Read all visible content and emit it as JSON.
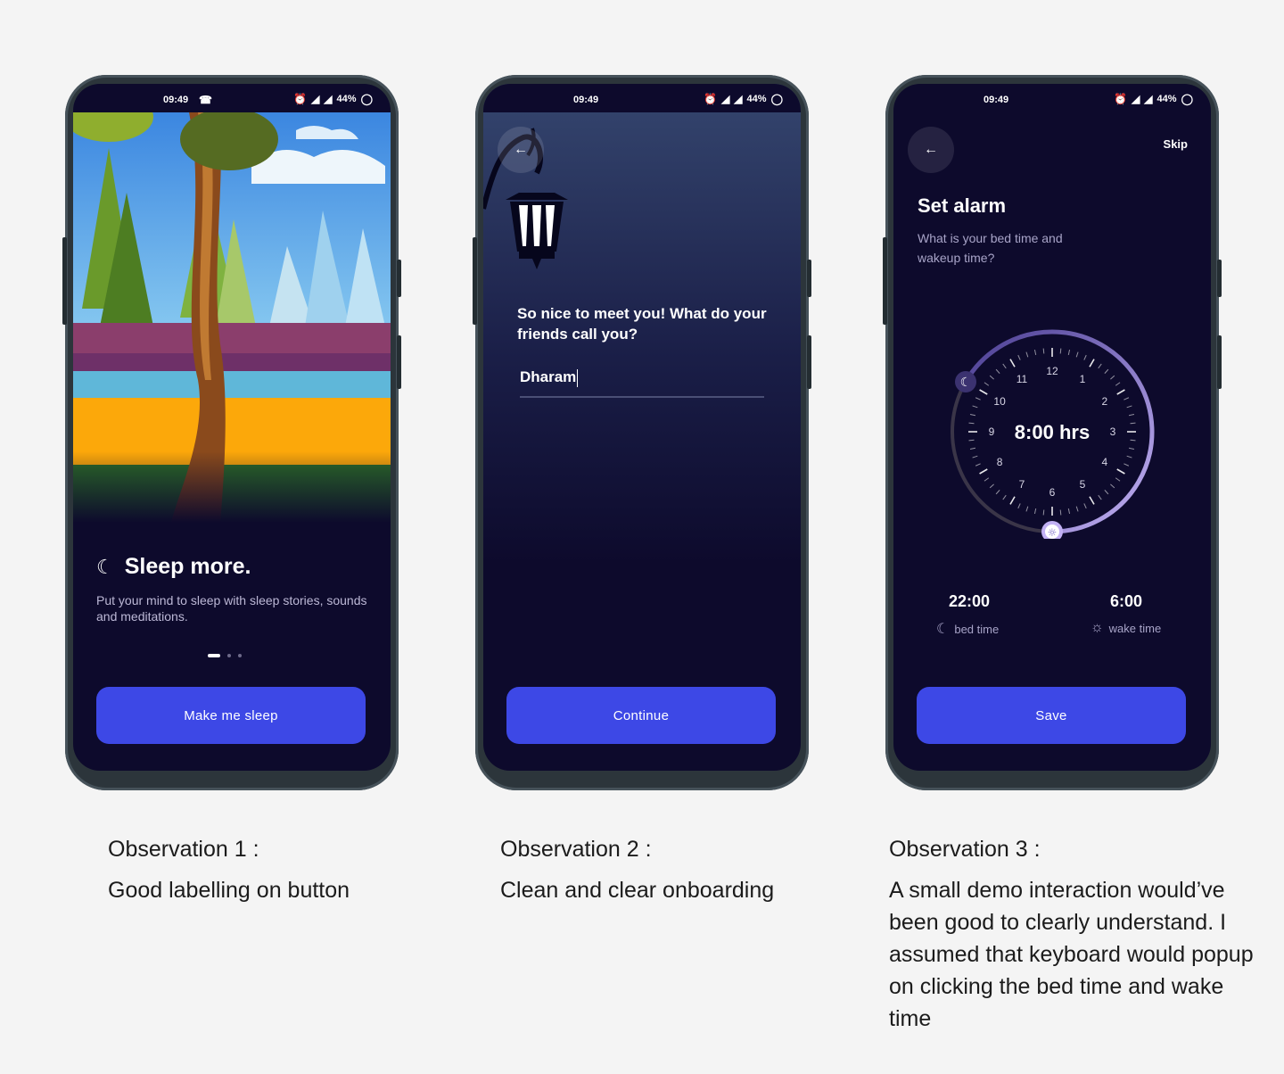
{
  "status_bar": {
    "time": "09:49",
    "battery": "44%"
  },
  "screen1": {
    "headline": "Sleep more.",
    "body": "Put your mind to sleep with sleep stories, sounds and meditations.",
    "button": "Make me sleep"
  },
  "screen2": {
    "question": "So nice to meet you! What do your friends call you?",
    "name_value": "Dharam",
    "button": "Continue"
  },
  "screen3": {
    "skip": "Skip",
    "title": "Set alarm",
    "subtitle": "What is your bed time and wakeup time?",
    "duration": "8:00 hrs",
    "clock_numbers": [
      "12",
      "1",
      "2",
      "3",
      "4",
      "5",
      "6",
      "7",
      "8",
      "9",
      "10",
      "11"
    ],
    "bed_time": "22:00",
    "bed_label": "bed time",
    "wake_time": "6:00",
    "wake_label": "wake time",
    "button": "Save"
  },
  "observations": [
    {
      "title": "Observation 1 :",
      "text": "Good labelling on button"
    },
    {
      "title": "Observation 2 :",
      "text": "Clean and clear onboarding"
    },
    {
      "title": "Observation 3 :",
      "text": "A small demo interaction would’ve been good to clearly understand. I assumed that keyboard would popup on clicking the bed time and wake time"
    }
  ],
  "colors": {
    "accent": "#3d48e6",
    "screen_bg": "#0d0a2c",
    "dial": "#b6a4ee"
  }
}
